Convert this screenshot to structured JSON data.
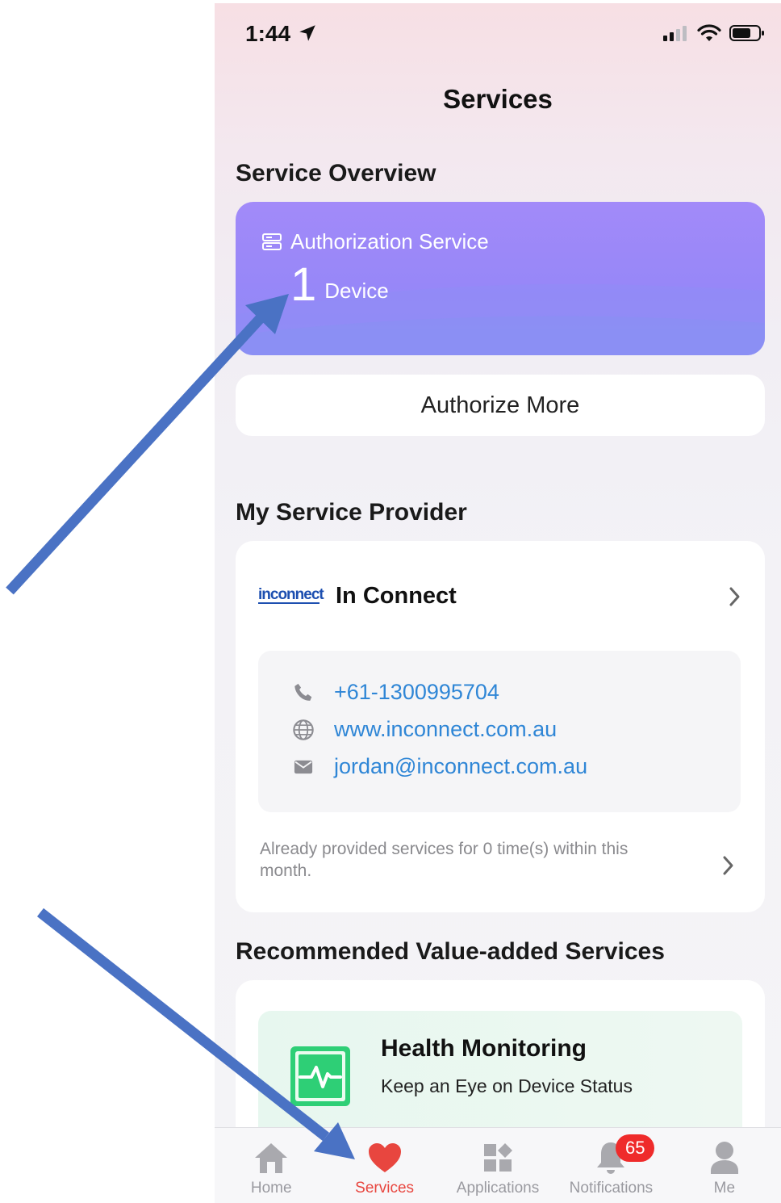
{
  "status_bar": {
    "time": "1:44"
  },
  "header": {
    "title": "Services"
  },
  "service_overview": {
    "title": "Service Overview",
    "card": {
      "label": "Authorization Service",
      "count": "1",
      "unit": "Device"
    },
    "authorize_button": "Authorize More"
  },
  "provider": {
    "section_title": "My Service Provider",
    "logo_text": "inconnect",
    "name": "In Connect",
    "phone": "+61-1300995704",
    "website": "www.inconnect.com.au",
    "email": "jordan@inconnect.com.au",
    "provided_text": "Already provided services for 0 time(s) within this month."
  },
  "recommended": {
    "section_title": "Recommended Value-added Services",
    "item": {
      "title": "Health Monitoring",
      "subtitle": "Keep an Eye on Device Status"
    }
  },
  "tabbar": {
    "tabs": [
      {
        "label": "Home",
        "icon": "home-icon"
      },
      {
        "label": "Services",
        "icon": "heart-icon"
      },
      {
        "label": "Applications",
        "icon": "grid-icon"
      },
      {
        "label": "Notifications",
        "icon": "bell-icon"
      },
      {
        "label": "Me",
        "icon": "person-icon"
      }
    ],
    "active": "Services",
    "notifications_badge": "65"
  },
  "colors": {
    "accent": "#e8463f",
    "link": "#2f86d6",
    "card_purple": "#9787f8",
    "annotation_arrow": "#4a72c4"
  }
}
